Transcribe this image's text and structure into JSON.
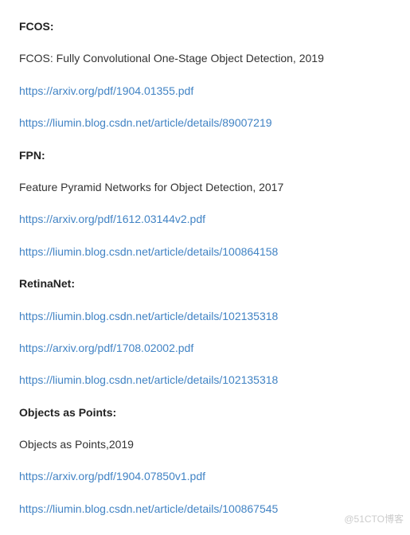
{
  "sections": [
    {
      "heading": "FCOS:",
      "items": [
        {
          "type": "text",
          "value": "FCOS: Fully Convolutional One-Stage Object Detection, 2019"
        },
        {
          "type": "link",
          "value": "https://arxiv.org/pdf/1904.01355.pdf"
        },
        {
          "type": "link",
          "value": "https://liumin.blog.csdn.net/article/details/89007219"
        }
      ]
    },
    {
      "heading": "FPN:",
      "items": [
        {
          "type": "text",
          "value": "Feature Pyramid Networks for Object Detection, 2017"
        },
        {
          "type": "link",
          "value": "https://arxiv.org/pdf/1612.03144v2.pdf"
        },
        {
          "type": "link",
          "value": "https://liumin.blog.csdn.net/article/details/100864158"
        }
      ]
    },
    {
      "heading": "RetinaNet:",
      "items": [
        {
          "type": "link",
          "value": "https://liumin.blog.csdn.net/article/details/102135318"
        },
        {
          "type": "link",
          "value": "https://arxiv.org/pdf/1708.02002.pdf"
        },
        {
          "type": "link",
          "value": "https://liumin.blog.csdn.net/article/details/102135318"
        }
      ]
    },
    {
      "heading": "Objects as Points:",
      "items": [
        {
          "type": "text",
          "value": "Objects as Points,2019"
        },
        {
          "type": "link",
          "value": "https://arxiv.org/pdf/1904.07850v1.pdf"
        },
        {
          "type": "link",
          "value": "https://liumin.blog.csdn.net/article/details/100867545"
        }
      ]
    }
  ],
  "watermark": "@51CTO博客"
}
